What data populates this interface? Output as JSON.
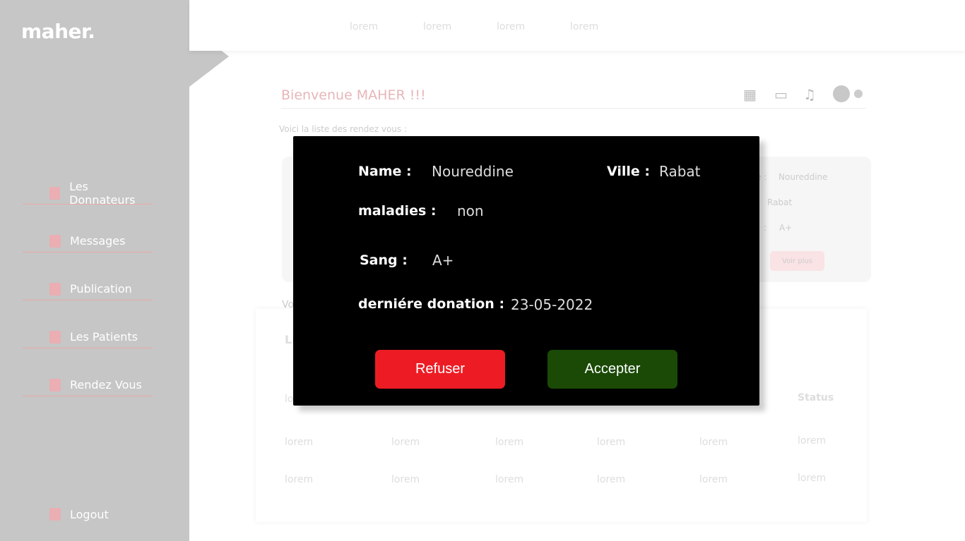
{
  "logo": "maher.",
  "sidebar": {
    "items": [
      {
        "label": "Les Donnateurs"
      },
      {
        "label": "Messages"
      },
      {
        "label": "Publication"
      },
      {
        "label": "Les Patients"
      },
      {
        "label": "Rendez Vous"
      }
    ],
    "logout": "Logout"
  },
  "topnav": [
    "lorem",
    "lorem",
    "lorem",
    "lorem"
  ],
  "header": {
    "welcome": "Bienvenue MAHER !!!",
    "subtitle": "Voici la liste des rendez vous  :"
  },
  "card": {
    "name_label": "e :",
    "name": "Noureddine",
    "ville": "Rabat",
    "sang_label": ":",
    "sang": "A+",
    "button": "Voir plus"
  },
  "section2": {
    "partial_text": "Vo",
    "title_partial": "Li",
    "col_partial": "lo",
    "status_header": "Status",
    "rows": [
      [
        "lorem",
        "lorem",
        "lorem",
        "lorem",
        "lorem",
        "lorem"
      ],
      [
        "lorem",
        "lorem",
        "lorem",
        "lorem",
        "lorem",
        "lorem"
      ]
    ]
  },
  "modal": {
    "name_label": "Name :",
    "name": "Noureddine",
    "ville_label": "Ville :",
    "ville": "Rabat",
    "maladies_label": "maladies  :",
    "maladies": "non",
    "sang_label": "Sang  :",
    "sang": "A+",
    "donation_label": "derniére donation  :",
    "donation": "23-05-2022",
    "refuse": "Refuser",
    "accept": "Accepter"
  },
  "colors": {
    "refuse": "#ed1c24",
    "accept": "#1a4a06",
    "sidebar": "#c6c6c6"
  }
}
